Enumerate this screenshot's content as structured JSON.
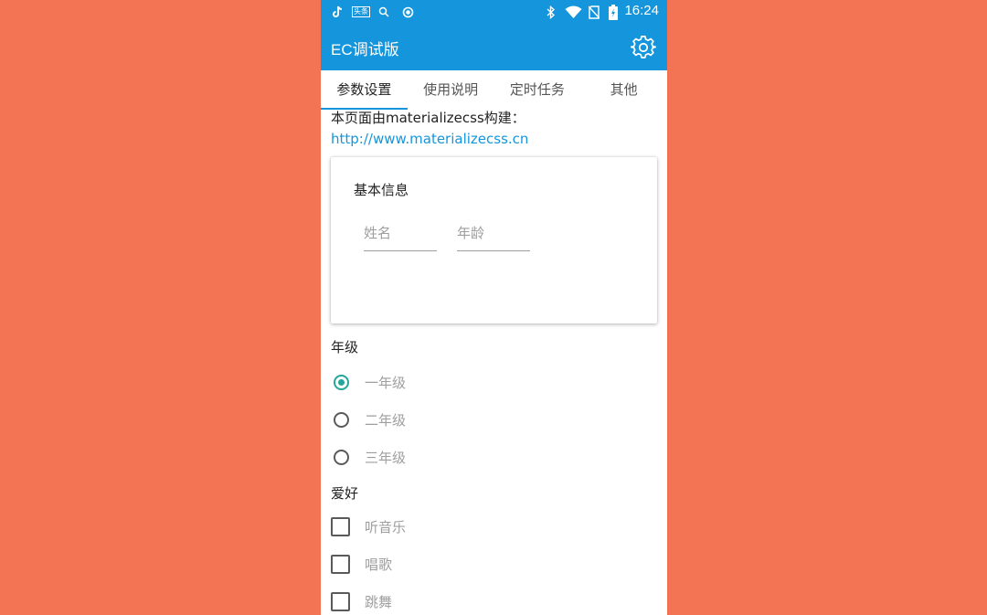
{
  "status_bar": {
    "time": "16:24",
    "left_icons": [
      "tiktok-icon",
      "news-app-icon",
      "search-icon",
      "record-icon"
    ],
    "right_icons": [
      "bluetooth-icon",
      "wifi-icon",
      "no-sim-icon",
      "battery-charging-icon"
    ],
    "news_label": "头条"
  },
  "app_bar": {
    "title": "EC调试版",
    "settings_icon": "gear-icon",
    "color": "#1596dc"
  },
  "tabs": [
    {
      "label": "参数设置",
      "active": true
    },
    {
      "label": "使用说明",
      "active": false
    },
    {
      "label": "定时任务",
      "active": false
    },
    {
      "label": "其他",
      "active": false
    }
  ],
  "intro": {
    "text": "本页面由materializecss构建：",
    "link": "http://www.materializecss.cn"
  },
  "card": {
    "title": "基本信息",
    "name_placeholder": "姓名",
    "age_placeholder": "年龄"
  },
  "grade": {
    "label": "年级",
    "options": [
      {
        "label": "一年级",
        "checked": true
      },
      {
        "label": "二年级",
        "checked": false
      },
      {
        "label": "三年级",
        "checked": false
      }
    ]
  },
  "hobby": {
    "label": "爱好",
    "options": [
      {
        "label": "听音乐",
        "checked": false
      },
      {
        "label": "唱歌",
        "checked": false
      },
      {
        "label": "跳舞",
        "checked": false
      }
    ]
  },
  "colors": {
    "primary": "#1596dc",
    "accent": "#26a69a",
    "background": "#f37355"
  }
}
